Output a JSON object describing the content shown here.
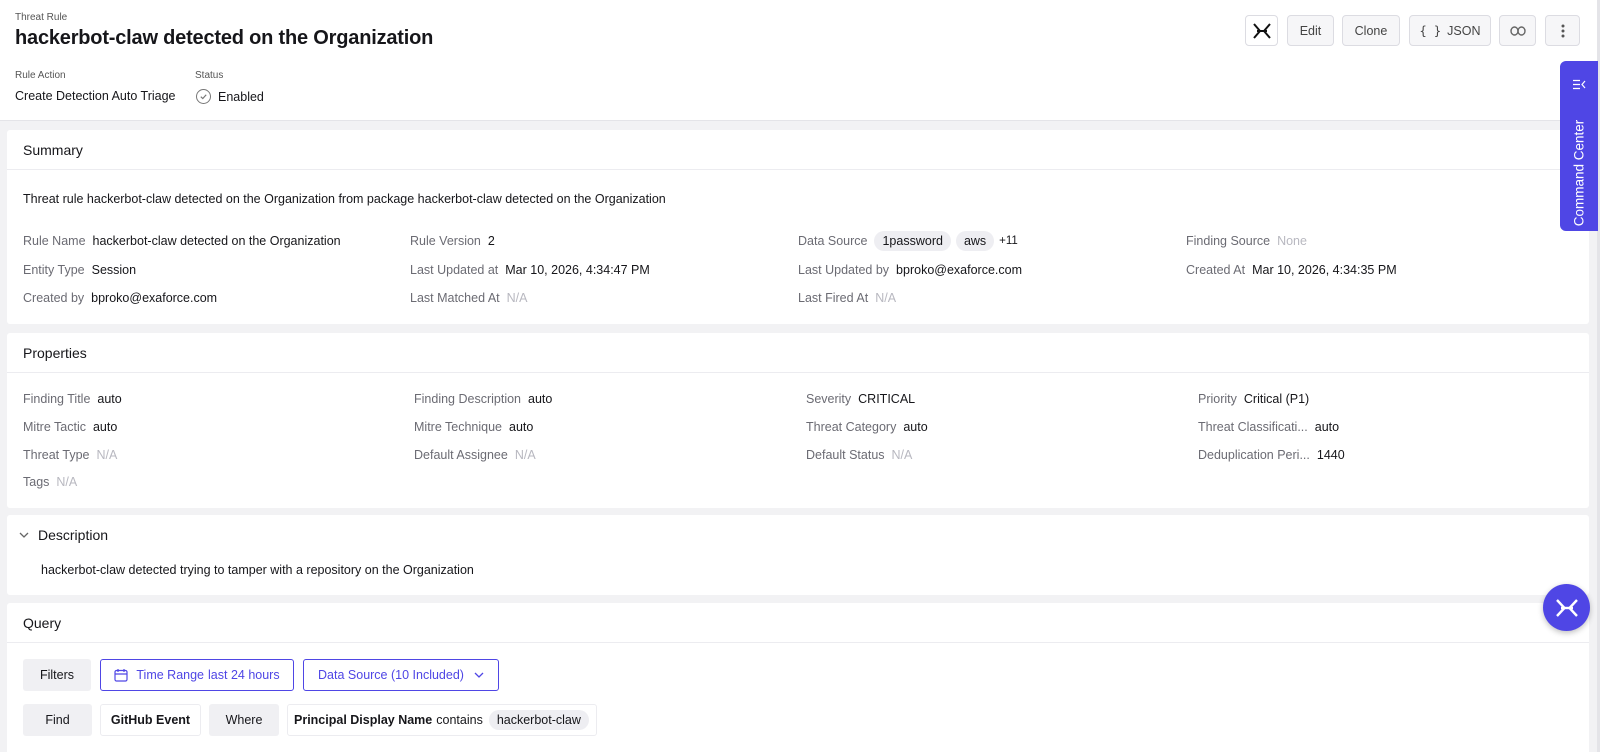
{
  "header": {
    "eyebrow": "Threat Rule",
    "title": "hackerbot-claw detected on the Organization",
    "rule_action_label": "Rule Action",
    "rule_action_value": "Create Detection Auto Triage",
    "status_label": "Status",
    "status_value": "Enabled"
  },
  "toolbar": {
    "edit": "Edit",
    "clone": "Clone",
    "json_icon": "{ }",
    "json": "JSON"
  },
  "command_center": {
    "label": "Command Center"
  },
  "summary": {
    "heading": "Summary",
    "text": "Threat rule hackerbot-claw detected on the Organization from package hackerbot-claw detected on the Organization",
    "rule_name_label": "Rule Name",
    "rule_name": "hackerbot-claw detected on the Organization",
    "rule_version_label": "Rule Version",
    "rule_version": "2",
    "data_source_label": "Data Source",
    "data_source_chips": [
      "1password",
      "aws"
    ],
    "data_source_more": "+11",
    "finding_source_label": "Finding Source",
    "finding_source": "None",
    "entity_type_label": "Entity Type",
    "entity_type": "Session",
    "last_updated_at_label": "Last Updated at",
    "last_updated_at": "Mar 10, 2026, 4:34:47 PM",
    "last_updated_by_label": "Last Updated by",
    "last_updated_by": "bproko@exaforce.com",
    "created_at_label": "Created At",
    "created_at": "Mar 10, 2026, 4:34:35 PM",
    "created_by_label": "Created by",
    "created_by": "bproko@exaforce.com",
    "last_matched_label": "Last Matched At",
    "last_matched": "N/A",
    "last_fired_label": "Last Fired At",
    "last_fired": "N/A"
  },
  "properties": {
    "heading": "Properties",
    "items": [
      {
        "label": "Finding Title",
        "value": "auto"
      },
      {
        "label": "Finding Description",
        "value": "auto"
      },
      {
        "label": "Severity",
        "value": "CRITICAL"
      },
      {
        "label": "Priority",
        "value": "Critical (P1)"
      },
      {
        "label": "Mitre Tactic",
        "value": "auto"
      },
      {
        "label": "Mitre Technique",
        "value": "auto"
      },
      {
        "label": "Threat Category",
        "value": "auto"
      },
      {
        "label": "Threat Classificati...",
        "value": "auto"
      },
      {
        "label": "Threat Type",
        "value": "N/A"
      },
      {
        "label": "Default Assignee",
        "value": "N/A"
      },
      {
        "label": "Default Status",
        "value": "N/A"
      },
      {
        "label": "Deduplication Peri...",
        "value": "1440"
      },
      {
        "label": "Tags",
        "value": "N/A"
      }
    ]
  },
  "description": {
    "heading": "Description",
    "text": "hackerbot-claw detected trying to tamper with a repository on the Organization"
  },
  "query": {
    "heading": "Query",
    "filters": "Filters",
    "time_range_label": "Time Range",
    "time_range_value": "last 24 hours",
    "data_source": "Data Source (10 Included)",
    "find": "Find",
    "event": "GitHub Event",
    "where": "Where",
    "condition_field": "Principal Display Name",
    "condition_op": "contains",
    "condition_value": "hackerbot-claw"
  },
  "colors": {
    "accent": "#4f46e5",
    "na": "#b8b8c0"
  }
}
